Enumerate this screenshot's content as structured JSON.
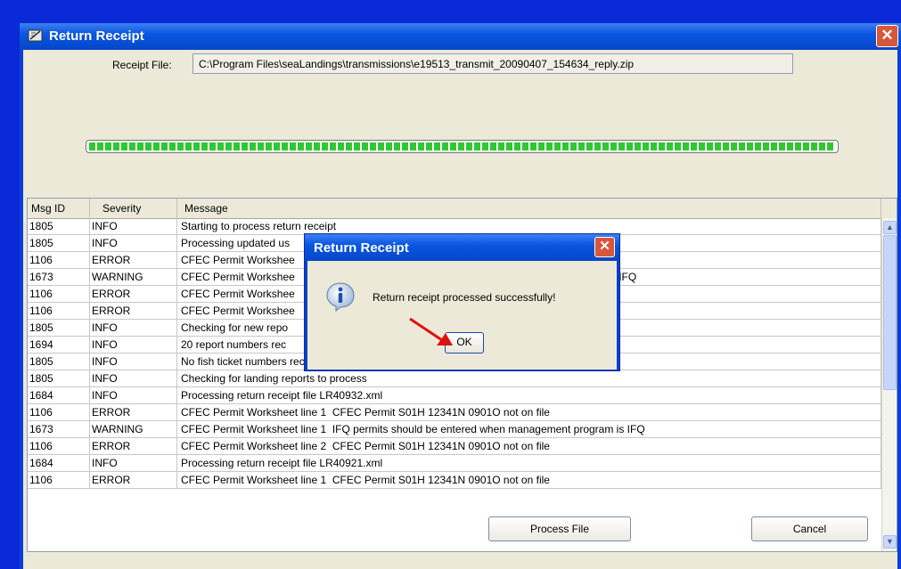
{
  "window": {
    "title": "Return Receipt"
  },
  "receipt": {
    "label": "Receipt File:",
    "path": "C:\\Program Files\\seaLandings\\transmissions\\e19513_transmit_20090407_154634_reply.zip"
  },
  "progress": {
    "value": 1.0
  },
  "table": {
    "columns": [
      "Msg ID",
      "Severity",
      "Message"
    ],
    "rows": [
      {
        "id": "1805",
        "severity": "INFO",
        "message": "Starting to process return receipt"
      },
      {
        "id": "1805",
        "severity": "INFO",
        "message": "Processing updated us"
      },
      {
        "id": "1106",
        "severity": "ERROR",
        "message": "CFEC Permit Workshee"
      },
      {
        "id": "1673",
        "severity": "WARNING",
        "message": "CFEC Permit Workshee                                                                                     ent program is IFQ"
      },
      {
        "id": "1106",
        "severity": "ERROR",
        "message": "CFEC Permit Workshee"
      },
      {
        "id": "1106",
        "severity": "ERROR",
        "message": "CFEC Permit Workshee"
      },
      {
        "id": "1805",
        "severity": "INFO",
        "message": "Checking for new repo"
      },
      {
        "id": "1694",
        "severity": "INFO",
        "message": "20 report numbers rec"
      },
      {
        "id": "1805",
        "severity": "INFO",
        "message": "No fish ticket numbers received in this return receipt, OK"
      },
      {
        "id": "1805",
        "severity": "INFO",
        "message": "Checking for landing reports to process"
      },
      {
        "id": "1684",
        "severity": "INFO",
        "message": "Processing return receipt file LR40932.xml"
      },
      {
        "id": "1106",
        "severity": "ERROR",
        "message": "CFEC Permit Worksheet line 1  CFEC Permit S01H 12341N 0901O not on file"
      },
      {
        "id": "1673",
        "severity": "WARNING",
        "message": "CFEC Permit Worksheet line 1  IFQ permits should be entered when management program is IFQ"
      },
      {
        "id": "1106",
        "severity": "ERROR",
        "message": "CFEC Permit Worksheet line 2  CFEC Permit S01H 12341N 0901O not on file"
      },
      {
        "id": "1684",
        "severity": "INFO",
        "message": "Processing return receipt file LR40921.xml"
      },
      {
        "id": "1106",
        "severity": "ERROR",
        "message": "CFEC Permit Worksheet line 1  CFEC Permit S01H 12341N 0901O not on file"
      }
    ]
  },
  "buttons": {
    "process": "Process File",
    "cancel": "Cancel"
  },
  "dialog": {
    "title": "Return Receipt",
    "message": "Return receipt processed successfully!",
    "ok": "OK",
    "icon": "info-icon"
  },
  "colors": {
    "titlebar": "#0a56e0",
    "progress": "#2ec92e",
    "annotation_arrow": "#e01010"
  }
}
